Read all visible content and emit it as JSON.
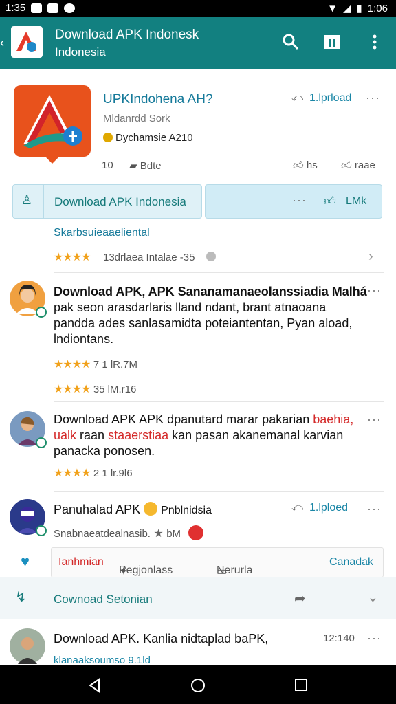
{
  "status": {
    "time_left": "1:35",
    "time_right": "1:06"
  },
  "appbar": {
    "title": "Download APK Indonesk",
    "subtitle": "Indonesia",
    "bg": "#128080"
  },
  "app": {
    "name": "UPKIndohena AH?",
    "developer": "Mldanrdd Sork",
    "version": "Dychamsie A210",
    "share_label": "1.lprload",
    "likes": "10",
    "bdte": "Bdte",
    "hs": "hs",
    "rate": "raae",
    "download_label": "Download APK Indonesia",
    "lmk_label": "LMk"
  },
  "subtitle_link": "Skarbsuieaaeliental",
  "rating_row": {
    "text": "13drlaea Intalae -35"
  },
  "posts": [
    {
      "lines": [
        "Download APK, APK Sananamanaeolanssiadia Malhá",
        "pak seon arasdarlaris lland ndant, brant atnaoana",
        "pandda ades sanlasamidta poteiantentan, Pyan aload,",
        "lndiontans."
      ],
      "meta1": "7 1 lR.7M",
      "meta2": "35 lM.r16"
    },
    {
      "lines_a": "Download APK APK dpanutard marar pakarian",
      "red_a": "baehia,",
      "red_b": "ualk",
      "lines_b_mid": " raan ",
      "red_c": "staaerstiaa",
      "lines_b_end": " kan pasan akanemanal karvian",
      "line_c": "panacka ponosen.",
      "meta": "2 1 lr.9l6"
    },
    {
      "title": "Panuhalad APK",
      "title_end": "Pnblnidsia",
      "share": "1.lploed",
      "sub": "Snabnaeatdealnasib.",
      "sub_end": "bM"
    }
  ],
  "actions": {
    "a1": "Ianhmian",
    "a2": "Pegjonlass",
    "a3": "Nerurla",
    "a4": "Canadak"
  },
  "section": {
    "label": "Cownoad Setonian"
  },
  "last_post": {
    "text": "Download APK. Kanlia nidtaplad baPK,",
    "time": "12:140",
    "sub": "klanaaksoumso 9.1ld"
  }
}
